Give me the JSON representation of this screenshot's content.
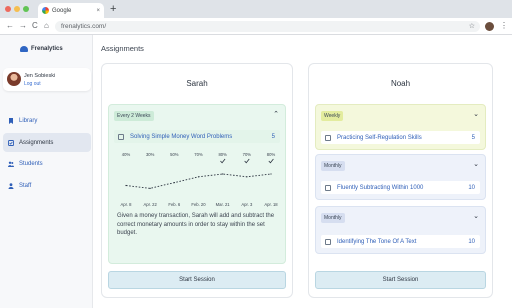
{
  "browser": {
    "tab_title": "Google",
    "tab_close": "×",
    "new_tab": "+",
    "back": "←",
    "forward": "→",
    "reload": "C",
    "home": "⌂",
    "url": "frenalytics.com/",
    "star": "☆",
    "menu": "⋮"
  },
  "sidebar": {
    "brand": "Frenalytics",
    "user": {
      "name": "Jen Sobieski",
      "logout": "Log out"
    },
    "items": [
      {
        "label": "Library",
        "icon": "bookmark-icon"
      },
      {
        "label": "Assignments",
        "icon": "assignments-icon"
      },
      {
        "label": "Students",
        "icon": "students-icon"
      },
      {
        "label": "Staff",
        "icon": "staff-icon"
      }
    ]
  },
  "main": {
    "title": "Assignments",
    "students": [
      {
        "name": "Sarah",
        "groups": [
          {
            "frequency": "Every 2 Weeks",
            "expanded": true,
            "skill": "Solving Simple Money Word Problems",
            "count": "5",
            "description": "Given a money transaction, Sarah will add and subtract the correct monetary amounts in order to stay within the set budget."
          }
        ],
        "start_label": "Start Session"
      },
      {
        "name": "Noah",
        "groups": [
          {
            "frequency": "Weekly",
            "skill": "Practicing Self-Regulation Skills",
            "count": "5"
          },
          {
            "frequency": "Monthly",
            "skill": "Fluently Subtracting Within 1000",
            "count": "10"
          },
          {
            "frequency": "Monthly",
            "skill": "Identifying The Tone Of A Text",
            "count": "10"
          }
        ],
        "start_label": "Start Session"
      }
    ]
  },
  "chart_data": {
    "type": "line",
    "categories": [
      "Apr. 8",
      "Apr. 22",
      "Feb. 6",
      "Feb. 20",
      "Mar. 21",
      "Apr. 3",
      "Apr. 18"
    ],
    "values": [
      40,
      30,
      50,
      70,
      80,
      70,
      80
    ],
    "value_labels": [
      "40%",
      "30%",
      "50%",
      "70%",
      "80%",
      "70%",
      "80%"
    ],
    "mastered": [
      false,
      false,
      false,
      false,
      true,
      true,
      true
    ],
    "ylim": [
      0,
      100
    ],
    "line_style": "dashed",
    "colors": {
      "line": "#2c3440",
      "check": "#2c3440"
    }
  }
}
